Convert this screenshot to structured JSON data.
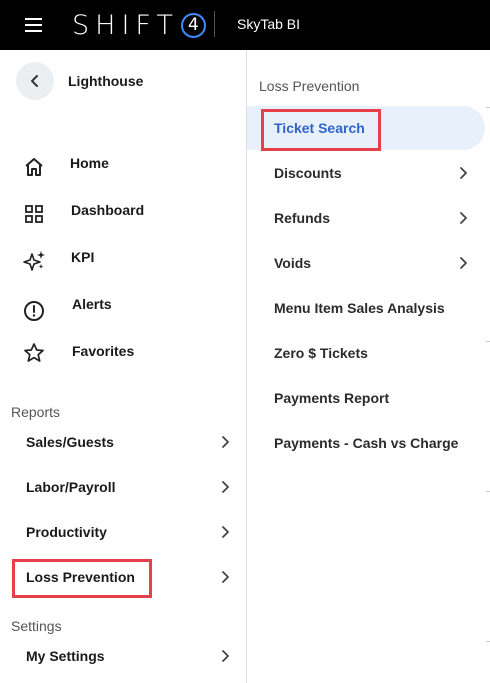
{
  "topbar": {
    "menu_icon": "hamburger-icon",
    "brand_word": "SHIFT",
    "brand_number": "4",
    "app_title": "SkyTab BI"
  },
  "sidebar": {
    "back_icon": "chevron-left-icon",
    "back_label": "Lighthouse",
    "nav_items": [
      {
        "label": "Home",
        "icon": "home-icon"
      },
      {
        "label": "Dashboard",
        "icon": "grid-icon"
      },
      {
        "label": "KPI",
        "icon": "sparkle-icon"
      },
      {
        "label": "Alerts",
        "icon": "alert-circle-icon"
      },
      {
        "label": "Favorites",
        "icon": "star-icon"
      }
    ],
    "reports_title": "Reports",
    "report_items": [
      {
        "label": "Sales/Guests"
      },
      {
        "label": "Labor/Payroll"
      },
      {
        "label": "Productivity"
      },
      {
        "label": "Loss Prevention",
        "highlighted": true
      }
    ],
    "settings_title": "Settings",
    "settings_items": [
      {
        "label": "My Settings"
      }
    ]
  },
  "panel": {
    "title": "Loss Prevention",
    "items": [
      {
        "label": "Ticket Search",
        "active": true,
        "highlighted": true,
        "has_submenu": false
      },
      {
        "label": "Discounts",
        "has_submenu": true
      },
      {
        "label": "Refunds",
        "has_submenu": true
      },
      {
        "label": "Voids",
        "has_submenu": true
      },
      {
        "label": "Menu Item Sales Analysis",
        "has_submenu": false
      },
      {
        "label": "Zero $ Tickets",
        "has_submenu": false
      },
      {
        "label": "Payments Report",
        "has_submenu": false
      },
      {
        "label": "Payments - Cash vs Charge",
        "has_submenu": false
      }
    ]
  },
  "colors": {
    "topbar_bg": "#000000",
    "brand_accent": "#3d8bff",
    "active_bg": "#e8f0fc",
    "active_text": "#2f63c9",
    "highlight_border": "#e8404a"
  }
}
